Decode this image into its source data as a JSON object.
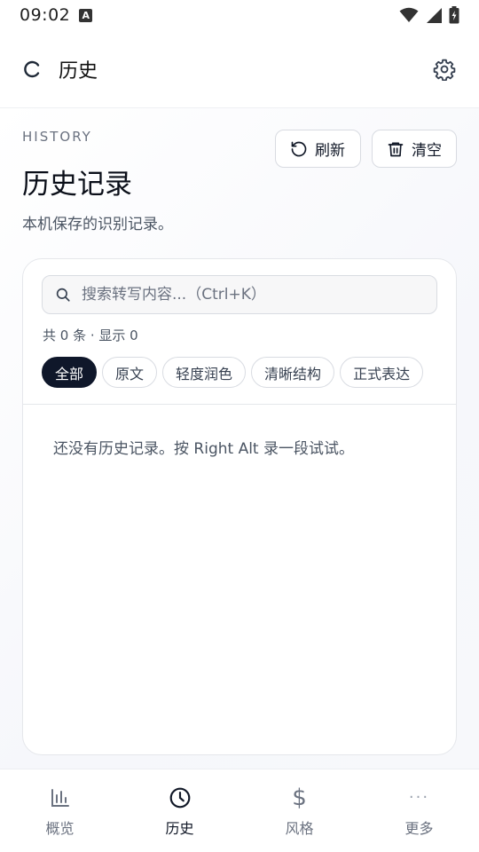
{
  "status_bar": {
    "time": "09:02",
    "badge": "A"
  },
  "app_bar": {
    "title": "历史"
  },
  "header": {
    "eyebrow": "HISTORY",
    "title": "历史记录",
    "subtitle": "本机保存的识别记录。",
    "refresh_label": "刷新",
    "clear_label": "清空"
  },
  "search": {
    "placeholder": "搜索转写内容...（Ctrl+K）",
    "value": ""
  },
  "count_text": "共 0 条 · 显示 0",
  "filters": [
    "全部",
    "原文",
    "轻度润色",
    "清晰结构",
    "正式表达"
  ],
  "active_filter": "全部",
  "empty_text": "还没有历史记录。按 Right Alt 录一段试试。",
  "bottom_nav": [
    {
      "label": "概览",
      "icon": "bar-chart-icon"
    },
    {
      "label": "历史",
      "icon": "clock-icon",
      "active": true
    },
    {
      "label": "风格",
      "icon": "dollar-icon"
    },
    {
      "label": "更多",
      "icon": "more-dots-icon"
    }
  ],
  "colors": {
    "accent_dark": "#0f172a",
    "muted": "#6b7280",
    "border": "#e5e7eb"
  }
}
